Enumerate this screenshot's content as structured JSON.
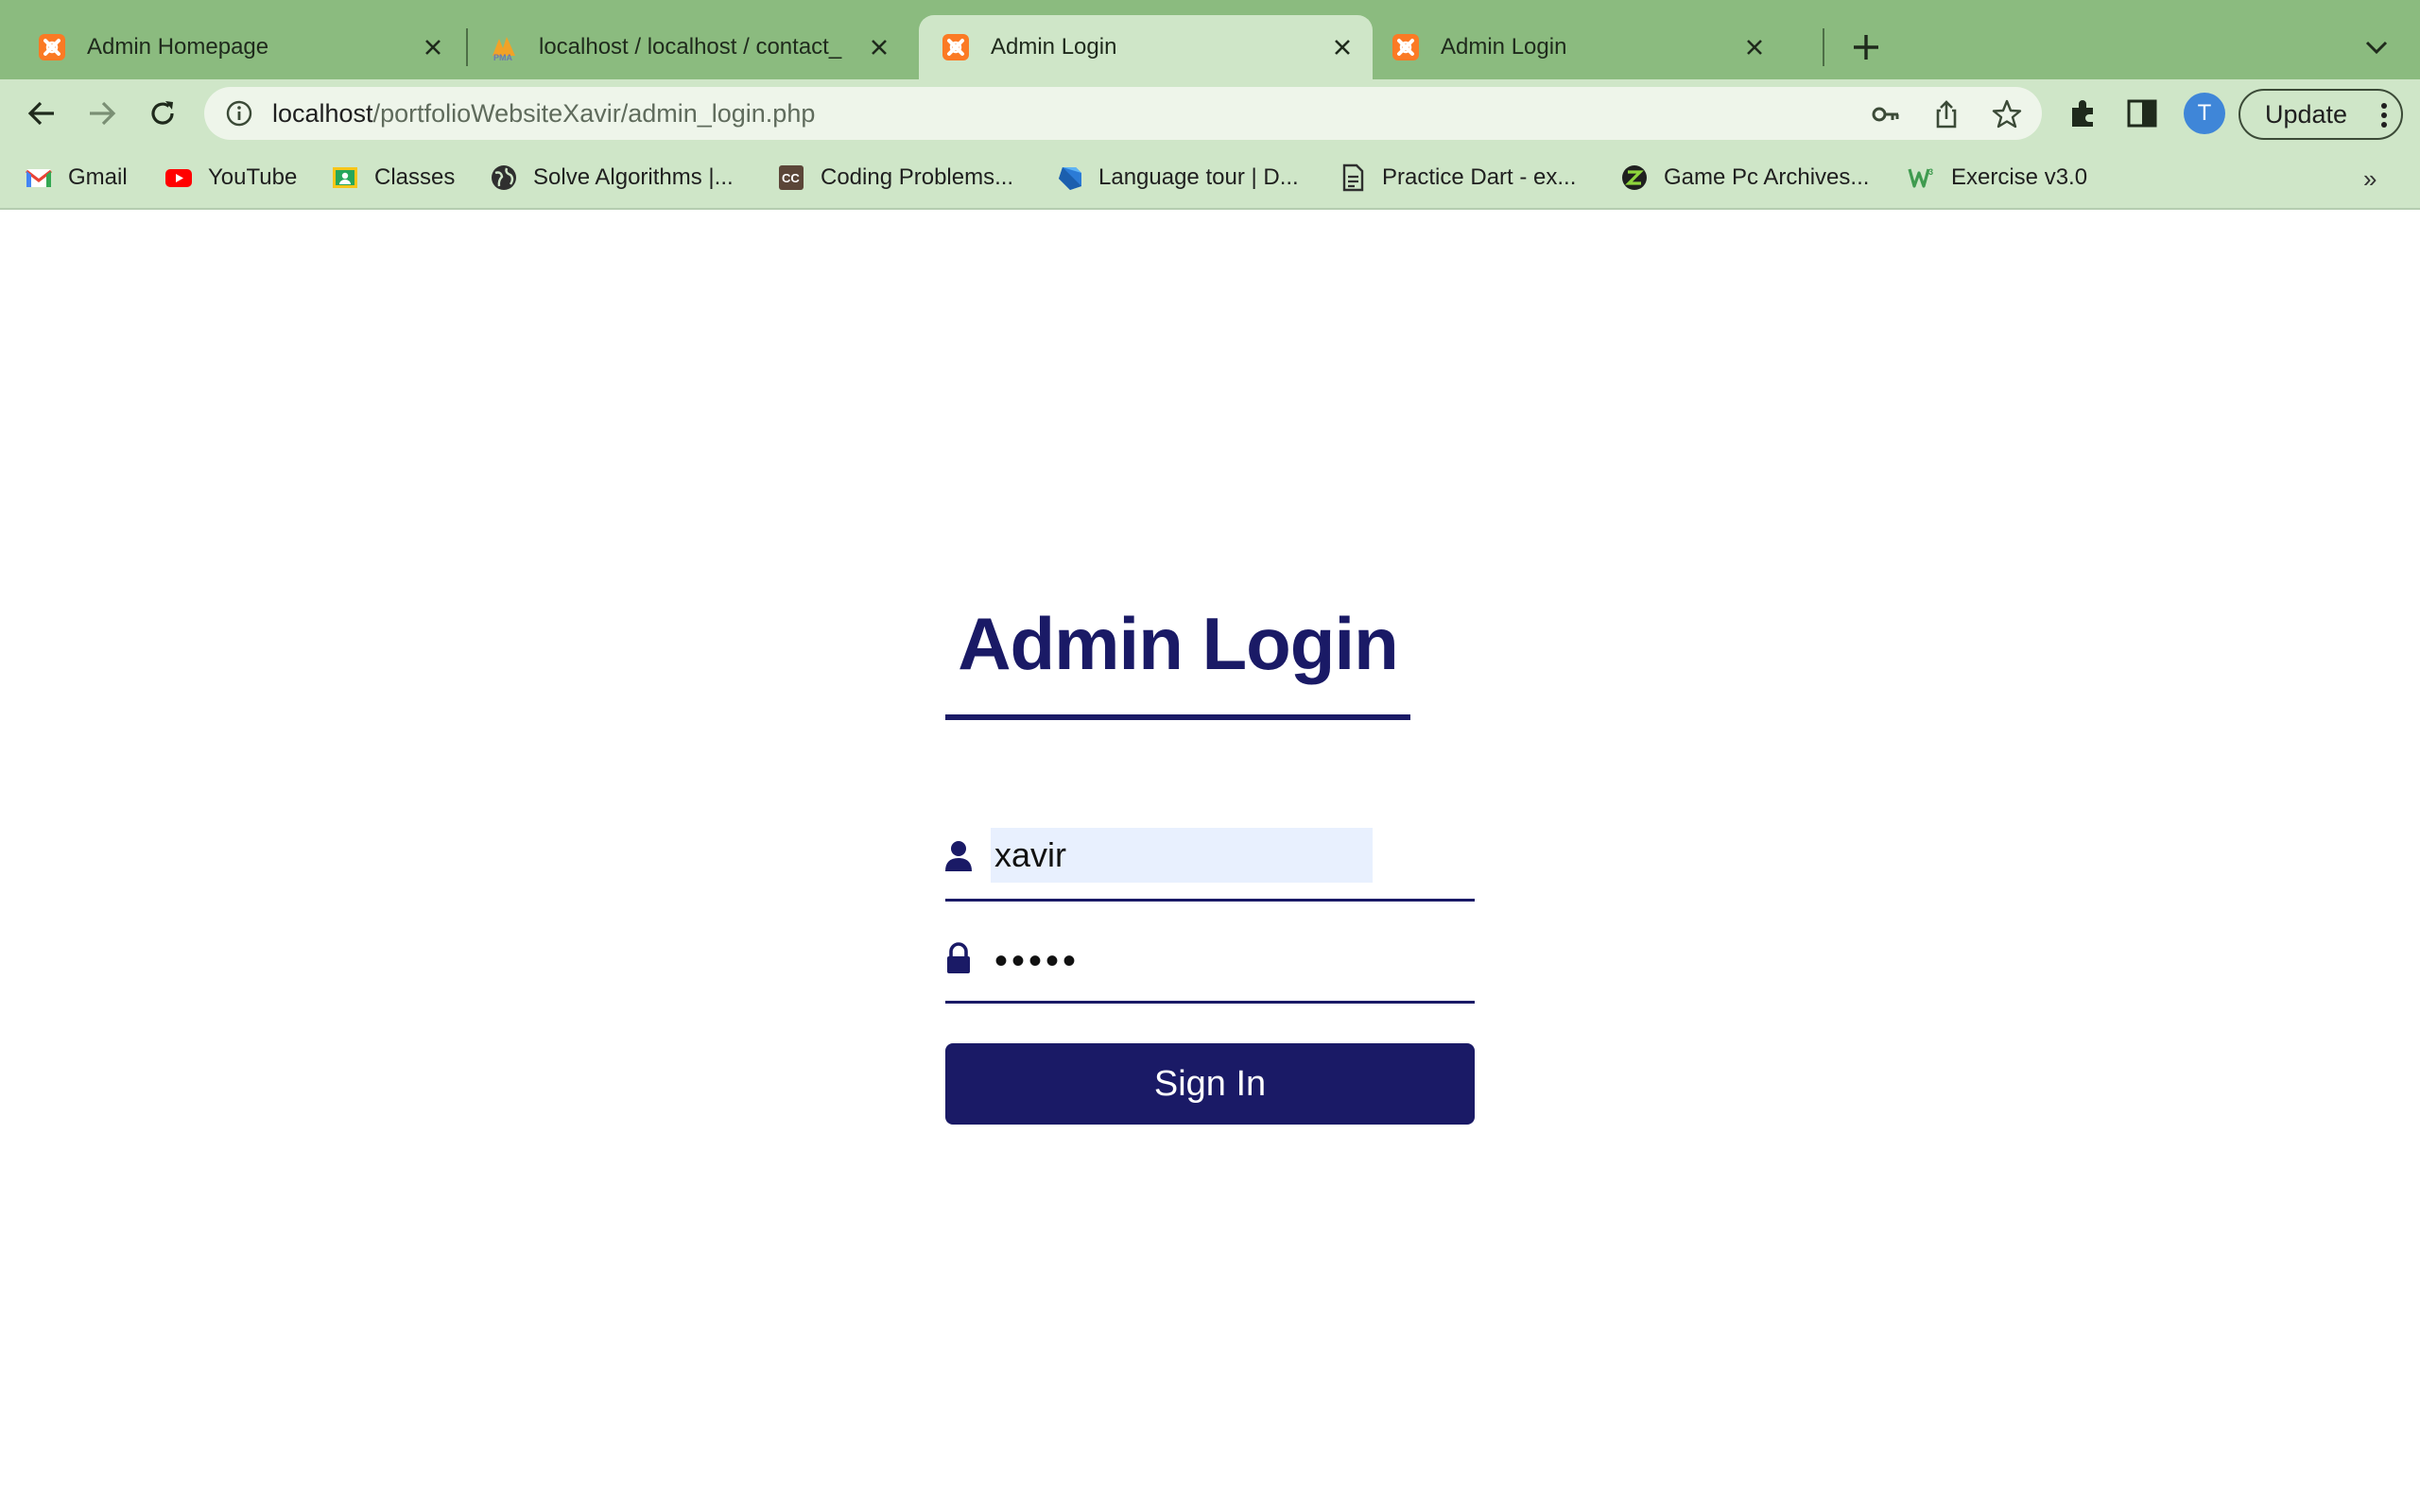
{
  "browser": {
    "tabs": [
      {
        "title": "Admin Homepage",
        "favicon": "xampp-icon",
        "active": false
      },
      {
        "title": "localhost / localhost / contact_",
        "favicon": "phpmyadmin-icon",
        "active": false
      },
      {
        "title": "Admin Login",
        "favicon": "xampp-icon",
        "active": true
      },
      {
        "title": "Admin Login",
        "favicon": "xampp-icon",
        "active": false
      }
    ],
    "url_host": "localhost",
    "url_path": "/portfolioWebsiteXavir/admin_login.php",
    "profile_initial": "T",
    "update_label": "Update",
    "bookmarks": [
      {
        "label": "Gmail",
        "icon": "gmail-icon"
      },
      {
        "label": "YouTube",
        "icon": "youtube-icon"
      },
      {
        "label": "Classes",
        "icon": "classroom-icon"
      },
      {
        "label": "Solve Algorithms |...",
        "icon": "globe-icon"
      },
      {
        "label": "Coding Problems...",
        "icon": "codechef-icon"
      },
      {
        "label": "Language tour | D...",
        "icon": "dart-icon"
      },
      {
        "label": "Practice Dart - ex...",
        "icon": "document-icon"
      },
      {
        "label": "Game Pc Archives...",
        "icon": "game-site-icon"
      },
      {
        "label": "Exercise v3.0",
        "icon": "w3schools-icon"
      }
    ],
    "bookmarks_more": "»"
  },
  "page": {
    "title": "Admin Login",
    "username_value": "xavir",
    "password_value": "•••••",
    "signin_label": "Sign In"
  },
  "colors": {
    "accent": "#1a1a66",
    "browser_frame": "#8bbb7f",
    "toolbar": "#cfe6c8",
    "autofill": "#e8f0fe"
  }
}
